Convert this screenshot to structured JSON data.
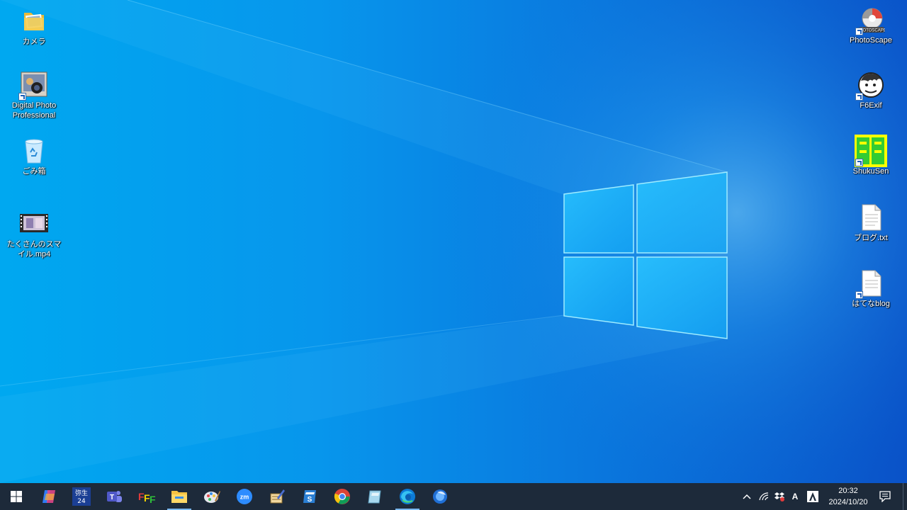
{
  "desktop": {
    "icons_left": [
      {
        "label": "カメラ",
        "icon": "folder-icon"
      },
      {
        "label": "Digital Photo Professional",
        "icon": "digital-photo-professional-icon"
      },
      {
        "label": "ごみ箱",
        "icon": "recycle-bin-icon"
      },
      {
        "label": "たくさんのスマイル.mp4",
        "icon": "video-file-icon"
      }
    ],
    "icons_right": [
      {
        "label": "PhotoScape",
        "icon": "photoscape-icon"
      },
      {
        "label": "F6Exif",
        "icon": "f6exif-icon"
      },
      {
        "label": "ShukuSen",
        "icon": "shukusen-icon"
      },
      {
        "label": "ブログ.txt",
        "icon": "text-file-icon"
      },
      {
        "label": "はてなblog",
        "icon": "text-file-shortcut-icon"
      }
    ]
  },
  "taskbar": {
    "start": "windows-start-icon",
    "pinned": [
      {
        "name": "copilot-icon"
      },
      {
        "name": "yayoi-icon",
        "text": "弥生\n24"
      },
      {
        "name": "teams-icon",
        "text": "T"
      },
      {
        "name": "ffftp-icon",
        "text": "FFF"
      },
      {
        "name": "file-explorer-icon",
        "active": true
      },
      {
        "name": "paint-icon"
      },
      {
        "name": "zoom-icon",
        "text": "zm"
      },
      {
        "name": "writing-app-icon"
      },
      {
        "name": "scan-app-icon",
        "text": "S"
      },
      {
        "name": "chrome-icon"
      },
      {
        "name": "notes-app-icon"
      },
      {
        "name": "edge-icon",
        "active": true
      },
      {
        "name": "blue-app-icon"
      }
    ],
    "tray": {
      "chevron": "^",
      "ime": "A",
      "time": "20:32",
      "date": "2024/10/20"
    }
  }
}
